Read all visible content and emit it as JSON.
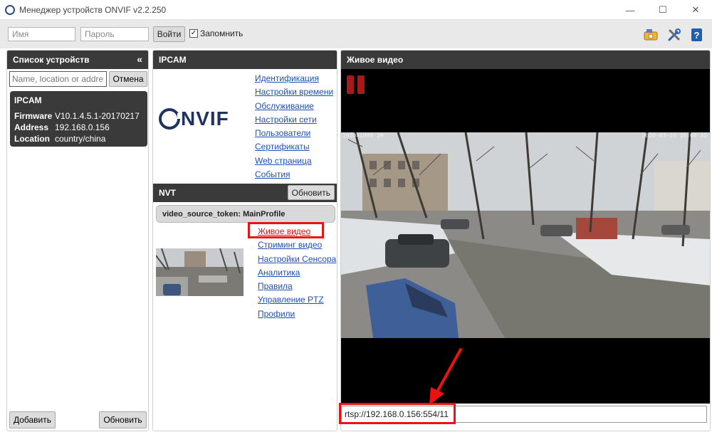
{
  "window": {
    "title": "Менеджер устройств ONVIF v2.2.250",
    "controls": {
      "minimize": "—",
      "maximize": "☐",
      "close": "✕"
    }
  },
  "toolbar": {
    "username_placeholder": "Имя",
    "password_placeholder": "Пароль",
    "login_label": "Войти",
    "remember_label": "Запомнить",
    "remember_checked": true,
    "icons": [
      "network-camera-icon",
      "tools-icon",
      "help-icon"
    ]
  },
  "device_list": {
    "title": "Список устройств",
    "collapse_glyph": "«",
    "search_placeholder": "Name, location or address",
    "cancel_label": "Отмена",
    "devices": [
      {
        "name": "IPCAM",
        "firmware_key": "Firmware",
        "firmware": "V10.1.4.5.1-20170217",
        "address_key": "Address",
        "address": "192.168.0.156",
        "location_key": "Location",
        "location": "country/china"
      }
    ],
    "add_label": "Добавить",
    "refresh_label": "Обновить"
  },
  "device_panel": {
    "title": "IPCAM",
    "logo_text": "NVIF",
    "links": [
      "Идентификация",
      "Настройки времени",
      "Обслуживание",
      "Настройки сети",
      "Пользователи",
      "Сертификаты",
      "Web страница",
      "События"
    ],
    "nvt_label": "NVT",
    "nvt_refresh_label": "Обновить",
    "profile_label": "video_source_token: MainProfile",
    "profile_links": [
      "Живое видео",
      "Стриминг видео",
      "Настройки Сенсора",
      "Аналитика",
      "Правила",
      "Управление PTZ",
      "Профили"
    ]
  },
  "live_video": {
    "title": "Живое видео",
    "osd_left": "1920×1080 2M",
    "osd_right": "2020-03-15 15:00:32",
    "stream_url": "rtsp://192.168.0.156:554/11"
  },
  "colors": {
    "header_bg": "#3a3a3a",
    "link": "#1f4fb5",
    "active_link": "#e11111",
    "highlight": "#e11111",
    "pause_icon": "#a81a1a"
  }
}
